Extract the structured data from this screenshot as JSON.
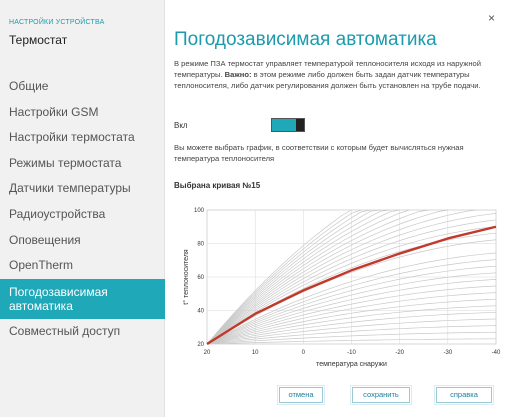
{
  "sidebar": {
    "subtitle": "НАСТРОЙКИ УСТРОЙСТВА",
    "title": "Термостат",
    "items": [
      {
        "label": "Общие",
        "active": false
      },
      {
        "label": "Настройки GSM",
        "active": false
      },
      {
        "label": "Настройки термостата",
        "active": false
      },
      {
        "label": "Режимы термостата",
        "active": false
      },
      {
        "label": "Датчики температуры",
        "active": false
      },
      {
        "label": "Радиоустройства",
        "active": false
      },
      {
        "label": "Оповещения",
        "active": false
      },
      {
        "label": "OpenTherm",
        "active": false
      },
      {
        "label": "Погодозависимая автоматика",
        "active": true
      },
      {
        "label": "Совместный доступ",
        "active": false
      }
    ]
  },
  "main": {
    "close_glyph": "×",
    "title": "Погодозависимая автоматика",
    "description_normal": "В режиме ПЗА термостат управляет температурой теплоносителя исходя из наружной температуры. ",
    "description_bold": "Важно:",
    "description_rest": " в этом режиме либо должен быть задан датчик температуры теплоносителя, либо датчик регулирования должен быть установлен на трубе подачи.",
    "toggle_label": "Вкл",
    "toggle_on": true,
    "hint": "Вы можете выбрать график, в соответствии с которым будет вычисляться нужная температура теплоносителя",
    "curve_label": "Выбрана кривая №15"
  },
  "buttons": {
    "cancel": "отмена",
    "save": "сохранить",
    "help": "справка"
  },
  "colors": {
    "accent": "#1ea8b8",
    "selected_curve": "#c0392b",
    "curve_grey": "#c8c8c8"
  },
  "chart_data": {
    "type": "line",
    "xlabel": "температура снаружи",
    "ylabel": "t° теплоносителя",
    "x_ticks": [
      "20",
      "10",
      "0",
      "-10",
      "-20",
      "-30",
      "-40"
    ],
    "y_ticks": [
      "20",
      "40",
      "60",
      "80",
      "100"
    ],
    "xlim": [
      20,
      -40
    ],
    "ylim": [
      20,
      100
    ],
    "grid": true,
    "curve_count": 30,
    "selected_curve": 15,
    "series": [
      {
        "x": [
          20,
          10,
          0,
          -10,
          -20,
          -30,
          -40
        ],
        "y": [
          20,
          38,
          52,
          64,
          74,
          83,
          90
        ]
      }
    ]
  }
}
